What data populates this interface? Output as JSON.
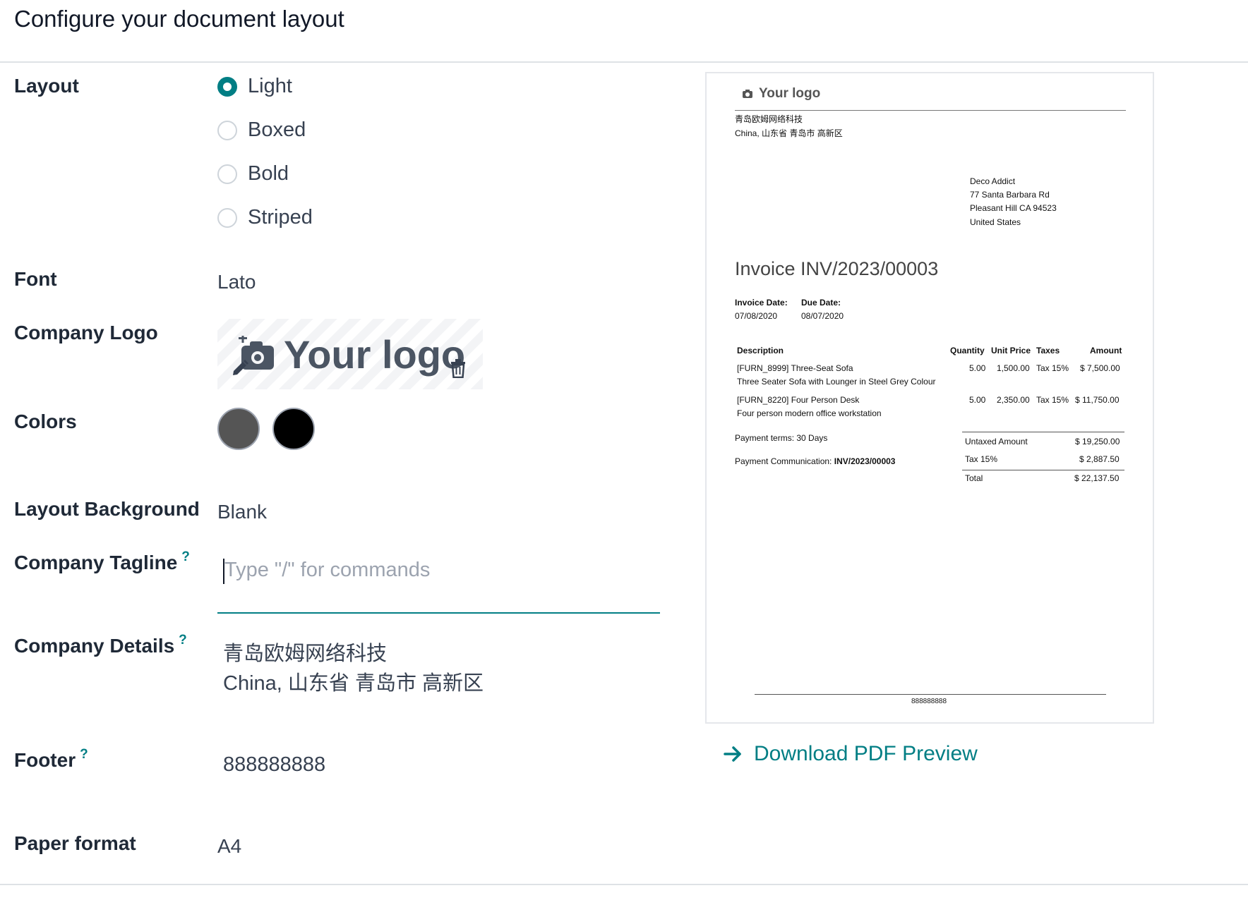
{
  "dialog": {
    "title": "Configure your document layout"
  },
  "form": {
    "layout": {
      "label": "Layout",
      "options": [
        "Light",
        "Boxed",
        "Bold",
        "Striped"
      ],
      "selected": "Light"
    },
    "font": {
      "label": "Font",
      "value": "Lato"
    },
    "company_logo": {
      "label": "Company Logo",
      "logo_text": "Your logo"
    },
    "colors": {
      "label": "Colors",
      "primary": "#555555",
      "secondary": "#000000"
    },
    "layout_background": {
      "label": "Layout Background",
      "value": "Blank"
    },
    "company_tagline": {
      "label": "Company Tagline",
      "help": "?",
      "placeholder": "Type \"/\" for commands",
      "value": ""
    },
    "company_details": {
      "label": "Company Details",
      "help": "?",
      "lines": [
        "青岛欧姆网络科技",
        "China, 山东省 青岛市 高新区"
      ]
    },
    "footer": {
      "label": "Footer",
      "help": "?",
      "value": "888888888"
    },
    "paper_format": {
      "label": "Paper format",
      "value": "A4"
    }
  },
  "preview": {
    "logo_text": "Your logo",
    "company_lines": [
      "青岛欧姆网络科技",
      "China, 山东省 青岛市 高新区"
    ],
    "customer_lines": [
      "Deco Addict",
      "77 Santa Barbara Rd",
      "Pleasant Hill CA 94523",
      "United States"
    ],
    "invoice_title": "Invoice INV/2023/00003",
    "invoice_date_label": "Invoice Date:",
    "invoice_date": "07/08/2020",
    "due_date_label": "Due Date:",
    "due_date": "08/07/2020",
    "table_headers": [
      "Description",
      "Quantity",
      "Unit Price",
      "Taxes",
      "Amount"
    ],
    "lines": [
      {
        "desc1": "[FURN_8999] Three-Seat Sofa",
        "desc2": "Three Seater Sofa with Lounger in Steel Grey Colour",
        "qty": "5.00",
        "price": "1,500.00",
        "tax": "Tax 15%",
        "amount": "$ 7,500.00"
      },
      {
        "desc1": "[FURN_8220] Four Person Desk",
        "desc2": "Four person modern office workstation",
        "qty": "5.00",
        "price": "2,350.00",
        "tax": "Tax 15%",
        "amount": "$ 11,750.00"
      }
    ],
    "payment_terms": "Payment terms: 30 Days",
    "payment_comm_label": "Payment Communication:",
    "payment_comm_value": "INV/2023/00003",
    "untaxed_label": "Untaxed Amount",
    "untaxed_value": "$ 19,250.00",
    "tax_label": "Tax 15%",
    "tax_value": "$ 2,887.50",
    "total_label": "Total",
    "total_value": "$ 22,137.50",
    "footer_text": "888888888"
  },
  "actions": {
    "download_label": "Download PDF Preview"
  },
  "icons": {
    "logo_camera": "camera-plus-icon",
    "logo_edit": "pencil-icon",
    "logo_delete": "trash-icon",
    "download": "arrow-right-icon"
  }
}
